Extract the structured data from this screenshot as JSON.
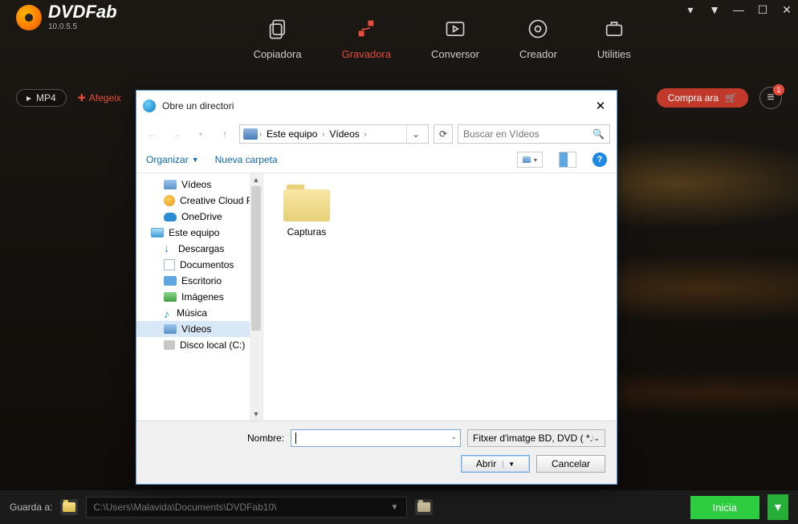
{
  "app": {
    "brand": "DVDFab",
    "version": "10.0.5.5"
  },
  "win_controls": {
    "badge": "1"
  },
  "nav": {
    "items": [
      {
        "label": "Copiadora",
        "name": "nav-copiadora"
      },
      {
        "label": "Gravadora",
        "name": "nav-gravadora"
      },
      {
        "label": "Conversor",
        "name": "nav-conversor"
      },
      {
        "label": "Creador",
        "name": "nav-creador"
      },
      {
        "label": "Utilities",
        "name": "nav-utilities"
      }
    ]
  },
  "toolbar": {
    "format_label": "MP4",
    "add_label": "Afegeix",
    "buy_label": "Compra ara",
    "menu_badge": "1"
  },
  "bottom": {
    "save_label": "Guarda a:",
    "path": "C:\\Users\\Malavida\\Documents\\DVDFab10\\",
    "start_label": "Inicia"
  },
  "dialog": {
    "title": "Obre un directori",
    "breadcrumb": {
      "root_icon": "videos",
      "seg1": "Este equipo",
      "seg2": "Vídeos"
    },
    "search_placeholder": "Buscar en Vídeos",
    "organize": "Organizar",
    "new_folder": "Nueva carpeta",
    "help": "?",
    "tree": [
      {
        "label": "Vídeos",
        "icon": "vid",
        "indent": true,
        "name": "tree-videos-top"
      },
      {
        "label": "Creative Cloud Fil",
        "icon": "cc",
        "indent": true,
        "name": "tree-creative-cloud"
      },
      {
        "label": "OneDrive",
        "icon": "od",
        "indent": true,
        "name": "tree-onedrive"
      },
      {
        "label": "Este equipo",
        "icon": "pc",
        "indent": false,
        "name": "tree-este-equipo"
      },
      {
        "label": "Descargas",
        "icon": "dl",
        "indent": true,
        "name": "tree-descargas"
      },
      {
        "label": "Documentos",
        "icon": "doc",
        "indent": true,
        "name": "tree-documentos"
      },
      {
        "label": "Escritorio",
        "icon": "desk",
        "indent": true,
        "name": "tree-escritorio"
      },
      {
        "label": "Imágenes",
        "icon": "img",
        "indent": true,
        "name": "tree-imagenes"
      },
      {
        "label": "Música",
        "icon": "mus",
        "indent": true,
        "name": "tree-musica"
      },
      {
        "label": "Vídeos",
        "icon": "vid",
        "indent": true,
        "name": "tree-videos",
        "selected": true
      },
      {
        "label": "Disco local (C:)",
        "icon": "disk",
        "indent": true,
        "name": "tree-disco-c"
      }
    ],
    "files": [
      {
        "label": "Capturas",
        "type": "folder",
        "name": "file-capturas"
      }
    ],
    "filename_label": "Nombre:",
    "filename_value": "",
    "filter_label": "Fitxer d'imatge BD, DVD ( *.ini *",
    "open_label": "Abrir",
    "cancel_label": "Cancelar"
  }
}
